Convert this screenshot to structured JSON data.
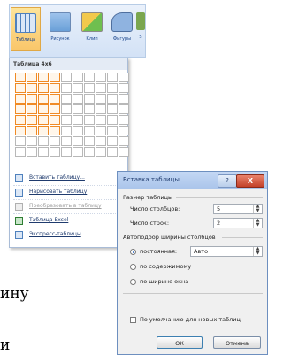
{
  "ribbon": {
    "buttons": [
      {
        "label": "Таблица",
        "icon": "table-grid-icon"
      },
      {
        "label": "Рисунок",
        "icon": "picture-icon"
      },
      {
        "label": "Клип",
        "icon": "clipart-icon"
      },
      {
        "label": "Фигуры",
        "icon": "shapes-icon"
      },
      {
        "label": "S",
        "icon": "smartart-icon"
      }
    ]
  },
  "dropdown": {
    "title": "Таблица 4x6",
    "grid": {
      "cols": 10,
      "rows": 8,
      "selected_cols": 4,
      "selected_rows": 6
    },
    "menu": [
      {
        "label": "Вставить таблицу...",
        "enabled": true
      },
      {
        "label": "Нарисовать таблицу",
        "enabled": true
      },
      {
        "label": "Преобразовать в таблицу",
        "enabled": false
      },
      {
        "label": "Таблица Excel",
        "enabled": true
      },
      {
        "label": "Экспресс-таблицы",
        "enabled": true
      }
    ]
  },
  "dialog": {
    "title": "Вставка таблицы",
    "help": "?",
    "close": "X",
    "size_section": "Размер таблицы",
    "cols_label": "Число столбцов:",
    "cols_value": "5",
    "rows_label": "Число строк:",
    "rows_value": "2",
    "autofit_section": "Автоподбор ширины столбцов",
    "radio_fixed": "постоянная:",
    "fixed_value": "Авто",
    "radio_content": "по содержимому",
    "radio_window": "по ширине окна",
    "default_checkbox": "По умолчанию для новых таблиц",
    "ok": "ОК",
    "cancel": "Отмена"
  },
  "background_text": {
    "line1": "ину",
    "line2": "и"
  },
  "colors": {
    "grid_selected": "#f08a24",
    "ribbon_active": "#f9c66a",
    "title_bar": "#a9c4ea"
  }
}
